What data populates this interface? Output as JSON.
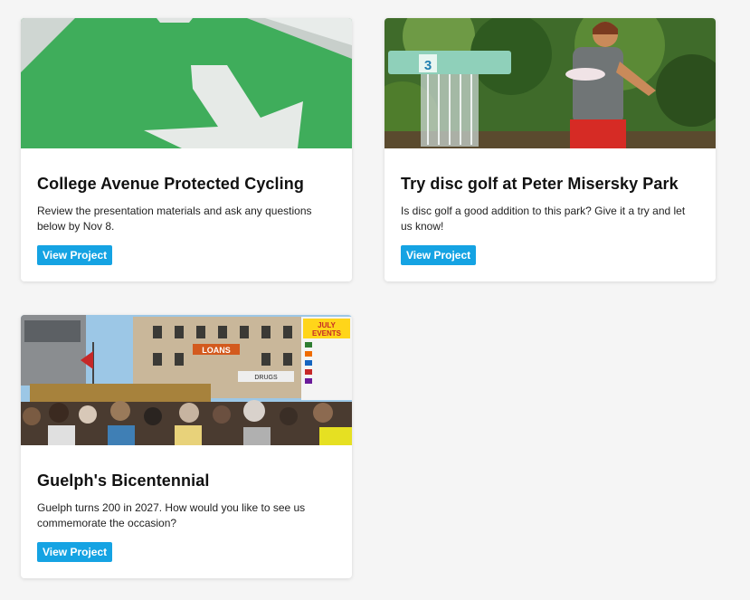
{
  "cards": [
    {
      "title": "College Avenue Protected Cycling",
      "description": "Review the presentation materials and ask any questions below by Nov 8.",
      "button_label": "View Project",
      "image_subject": "green cycling lane with white arrow"
    },
    {
      "title": "Try disc golf at Peter Misersky Park",
      "description": "Is disc golf a good addition to this park? Give it a try and let us know!",
      "button_label": "View Project",
      "image_subject": "child throwing disc at disc golf basket",
      "image_sign": "3"
    },
    {
      "title": "Guelph's Bicentennial",
      "description": "Guelph turns 200 in 2027. How would you like to see us commemorate the occasion?",
      "button_label": "View Project",
      "image_subject": "crowd at downtown celebration with buildings",
      "image_signs": [
        "JULY",
        "EVENTS",
        "LOANS",
        "DRUGS"
      ]
    }
  ],
  "colors": {
    "button": "#15a3e3",
    "background": "#f5f5f5",
    "card": "#ffffff"
  }
}
